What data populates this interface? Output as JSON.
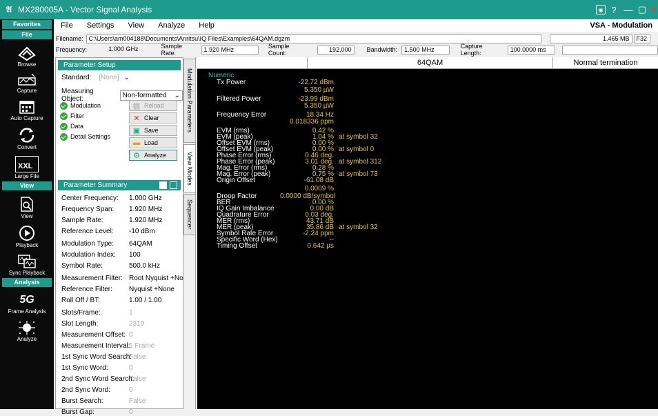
{
  "app": {
    "title": "MX280005A - Vector Signal Analysis",
    "mode": "VSA - Modulation"
  },
  "menu": [
    "File",
    "Settings",
    "View",
    "Analyze",
    "Help"
  ],
  "sidebar": {
    "favorites_header": "Favorites",
    "file_header": "File",
    "view_header": "View",
    "analysis_header": "Analysis",
    "items": {
      "browse": "Browse",
      "capture": "Capture",
      "auto_capture": "Auto Capture",
      "convert": "Convert",
      "large_file": "Large File",
      "view": "View",
      "playback": "Playback",
      "sync_playback": "Sync Playback",
      "frame_analysis": "Frame Analysis",
      "analyze": "Analyze"
    },
    "xxl": "XXL",
    "fiveg": "5G"
  },
  "info": {
    "filename_label": "Filename:",
    "filename": "C:\\Users\\am004188\\Documents\\Anritsu\\IQ Files\\Examples\\64QAM.dgzm",
    "file_size": "1.465 MB",
    "format": "F32",
    "frequency_label": "Frequency:",
    "frequency": "1.000 GHz",
    "sample_rate_label": "Sample Rate:",
    "sample_rate": "1.920 MHz",
    "sample_count_label": "Sample Count:",
    "sample_count": "192,000",
    "bandwidth_label": "Bandwidth:",
    "bandwidth": "1.500 MHz",
    "capture_length_label": "Capture Length:",
    "capture_length": "100.0000 ms"
  },
  "setup": {
    "header": "Parameter Setup",
    "standard_label": "Standard:",
    "standard_value": "[None]",
    "measuring_object_label": "Measuring Object:",
    "measuring_object_value": "Non-formatted",
    "checks": [
      "Modulation",
      "Filter",
      "Data",
      "Detail Settings"
    ],
    "buttons": {
      "reload": "Reload",
      "clear": "Clear",
      "save": "Save",
      "load": "Load",
      "analyze": "Analyze"
    }
  },
  "summary": {
    "header": "Parameter Summary",
    "rows": [
      {
        "k": "Center Frequency:",
        "v": "1.000 GHz"
      },
      {
        "k": "Frequency Span:",
        "v": "1.920 MHz"
      },
      {
        "k": "Sample Rate:",
        "v": "1.920 MHz"
      },
      {
        "k": "Reference Level:",
        "v": "-10 dBm"
      },
      {
        "k": "Modulation Type:",
        "v": "64QAM"
      },
      {
        "k": "Modulation Index:",
        "v": "100"
      },
      {
        "k": "Symbol Rate:",
        "v": "500.0 kHz"
      },
      {
        "k": "Measurement Filter:",
        "v": "Root Nyquist +None"
      },
      {
        "k": "Reference Filter:",
        "v": "Nyquist +None"
      },
      {
        "k": "Roll Off / BT:",
        "v": "1.00 / 1.00"
      },
      {
        "k": "Slots/Frame:",
        "v": "1"
      },
      {
        "k": "Slot Length:",
        "v": "2310"
      },
      {
        "k": "Measurement Offset:",
        "v": "0"
      },
      {
        "k": "Measurement Interval:",
        "v": "1 Frame"
      },
      {
        "k": "1st Sync Word Search:",
        "v": "False"
      },
      {
        "k": "1st Sync Word:",
        "v": "0"
      },
      {
        "k": "2nd Sync Word Search:",
        "v": "False"
      },
      {
        "k": "2nd Sync Word:",
        "v": "0"
      },
      {
        "k": "Burst Search:",
        "v": "False"
      },
      {
        "k": "Burst Gap:",
        "v": "0"
      }
    ]
  },
  "vtabs": [
    "Modulation Parameters",
    "View Modes",
    "Sequencer"
  ],
  "results": {
    "title": "64QAM",
    "status": "Normal termination",
    "section": "Numeric",
    "rows": [
      {
        "label": "Tx Power",
        "value": "-22.72 dBm",
        "extra": ""
      },
      {
        "label": "",
        "value": "5.350 µW",
        "extra": ""
      },
      {
        "label": "Filtered Power",
        "value": "-23.99 dBm",
        "extra": ""
      },
      {
        "label": "",
        "value": "5.350 µW",
        "extra": ""
      },
      {
        "label": "Frequency Error",
        "value": "18.34 Hz",
        "extra": ""
      },
      {
        "label": "",
        "value": "0.018336 ppm",
        "extra": ""
      },
      {
        "label": "EVM (rms)",
        "value": "0.42 %",
        "extra": ""
      },
      {
        "label": "EVM (peak)",
        "value": "1.04 %",
        "extra": "at symbol 32"
      },
      {
        "label": "Offset EVM (rms)",
        "value": "0.00 %",
        "extra": ""
      },
      {
        "label": "Offset EVM (peak)",
        "value": "0.00 %",
        "extra": "at symbol 0"
      },
      {
        "label": "Phase Error (rms)",
        "value": "0.46 deg.",
        "extra": ""
      },
      {
        "label": "Phase Error (peak)",
        "value": "3.01 deg.",
        "extra": "at symbol 312"
      },
      {
        "label": "Mag. Error (rms)",
        "value": "0.28 %",
        "extra": ""
      },
      {
        "label": "Mag. Error (peak)",
        "value": "0.75 %",
        "extra": "at symbol 73"
      },
      {
        "label": "Origin Offset",
        "value": "-61.08 dB",
        "extra": ""
      },
      {
        "label": "",
        "value": "0.0009 %",
        "extra": ""
      },
      {
        "label": "Droop Factor",
        "value": "0.0000 dB/symbol",
        "extra": ""
      },
      {
        "label": "BER",
        "value": "0.00 %",
        "extra": ""
      },
      {
        "label": "IQ Gain Imbalance",
        "value": "0.00 dB",
        "extra": ""
      },
      {
        "label": "Quadrature Error",
        "value": "0.03 deg.",
        "extra": ""
      },
      {
        "label": "MER (rms)",
        "value": "43.71 dB",
        "extra": ""
      },
      {
        "label": "MER (peak)",
        "value": "35.86 dB",
        "extra": "at symbol 32"
      },
      {
        "label": "Symbol Rate Error",
        "value": "-2.24 ppm",
        "extra": ""
      },
      {
        "label": "Specific Word (Hex)",
        "value": "--",
        "extra": ""
      },
      {
        "label": "Timing Offset",
        "value": "0.642 µs",
        "extra": ""
      }
    ]
  },
  "colors": {
    "accent": "#1f9b8e",
    "value": "#e8c320",
    "numeric_header": "#22c2b0"
  }
}
